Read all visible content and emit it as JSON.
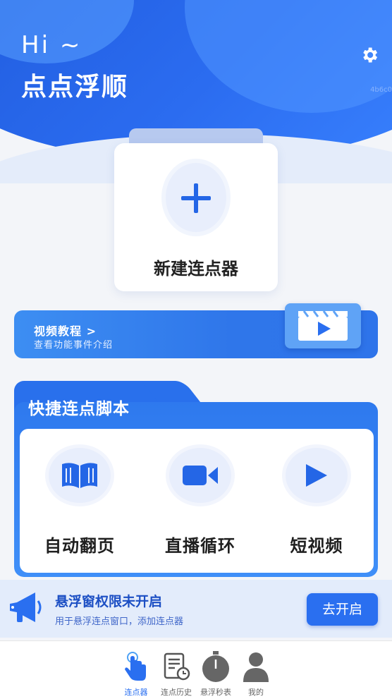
{
  "header": {
    "greeting": "Hi ~",
    "app_name": "点点浮顺",
    "watermark": "4b6c0"
  },
  "new_clicker": {
    "label": "新建连点器"
  },
  "tutorial_banner": {
    "title": "视频教程 >",
    "subtitle": "查看功能事件介绍"
  },
  "quick_scripts": {
    "title": "快捷连点脚本",
    "items": [
      {
        "label": "自动翻页",
        "icon": "book-icon"
      },
      {
        "label": "直播循环",
        "icon": "video-camera-icon"
      },
      {
        "label": "短视频",
        "icon": "play-icon"
      }
    ]
  },
  "permission_notice": {
    "title": "悬浮窗权限未开启",
    "subtitle": "用于悬浮连点窗口，添加连点器",
    "button": "去开启"
  },
  "tabbar": {
    "tabs": [
      {
        "label": "连点器",
        "icon": "tap-hand-icon",
        "active": true
      },
      {
        "label": "连点历史",
        "icon": "history-document-icon",
        "active": false
      },
      {
        "label": "悬浮秒表",
        "icon": "stopwatch-icon",
        "active": false
      },
      {
        "label": "我的",
        "icon": "person-icon",
        "active": false
      }
    ]
  },
  "colors": {
    "primary": "#2a6ff0",
    "header_dark": "#1d57d8",
    "light_bg": "#e3ecfb"
  }
}
